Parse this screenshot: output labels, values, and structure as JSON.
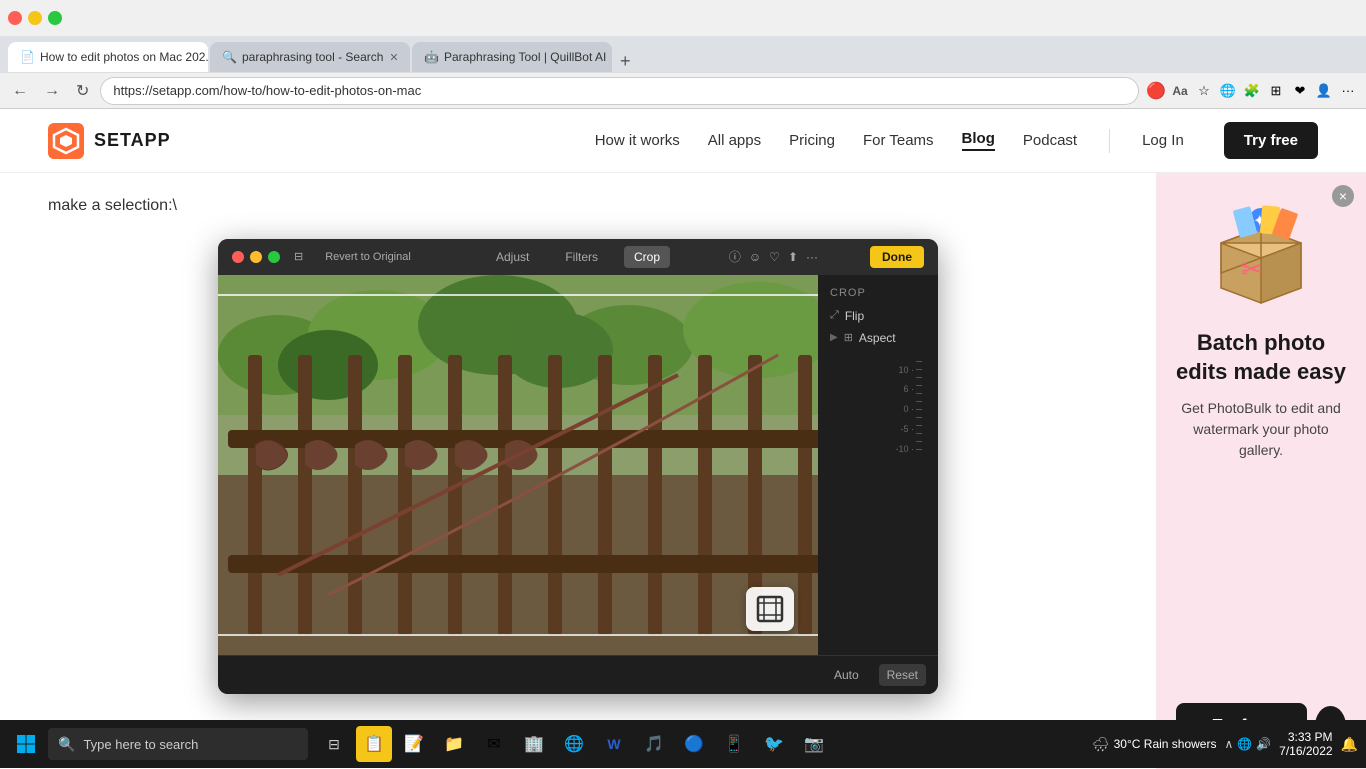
{
  "browser": {
    "tabs": [
      {
        "id": "tab1",
        "title": "How to edit photos on Mac 202...",
        "url": "https://setapp.com/how-to/how-to-edit-photos-on-mac",
        "active": true,
        "favicon": "📄"
      },
      {
        "id": "tab2",
        "title": "paraphrasing tool - Search",
        "url": "https://www.bing.com",
        "active": false,
        "favicon": "🔍"
      },
      {
        "id": "tab3",
        "title": "Paraphrasing Tool | QuillBot AI",
        "url": "https://quillbot.com",
        "active": false,
        "favicon": "🤖"
      }
    ],
    "address": "https://setapp.com/how-to/how-to-edit-photos-on-mac",
    "new_tab_label": "+"
  },
  "nav": {
    "logo_text": "SETAPP",
    "links": [
      {
        "label": "How it works",
        "active": false
      },
      {
        "label": "All apps",
        "active": false
      },
      {
        "label": "Pricing",
        "active": false
      },
      {
        "label": "For Teams",
        "active": false
      },
      {
        "label": "Blog",
        "active": true
      },
      {
        "label": "Podcast",
        "active": false
      }
    ],
    "login_label": "Log In",
    "try_free_label": "Try free"
  },
  "article": {
    "intro_text": "make a selection:\\",
    "mac_window": {
      "revert_label": "Revert to Original",
      "tool_adjust": "Adjust",
      "tool_filters": "Filters",
      "tool_crop": "Crop",
      "done_label": "Done",
      "crop_section_title": "CROP",
      "flip_label": "Flip",
      "aspect_label": "Aspect",
      "numbers": [
        "10 ·",
        "6 ·",
        "0 ·",
        "-5 ·",
        "-10 ·"
      ],
      "auto_label": "Auto",
      "reset_label": "Reset"
    }
  },
  "ad": {
    "title": "Batch photo edits made easy",
    "description": "Get PhotoBulk to edit and watermark your photo gallery.",
    "try_free_label": "Try free",
    "close_label": "×"
  },
  "taskbar": {
    "search_placeholder": "Type here to search",
    "time": "3:33 PM",
    "date": "7/16/2022",
    "weather": "30°C  Rain showers",
    "apps": [
      "🗂",
      "📋",
      "📁",
      "✉",
      "🏢",
      "🌐",
      "W",
      "🎵",
      "🌐",
      "📱",
      "🐦",
      "🎙"
    ]
  }
}
